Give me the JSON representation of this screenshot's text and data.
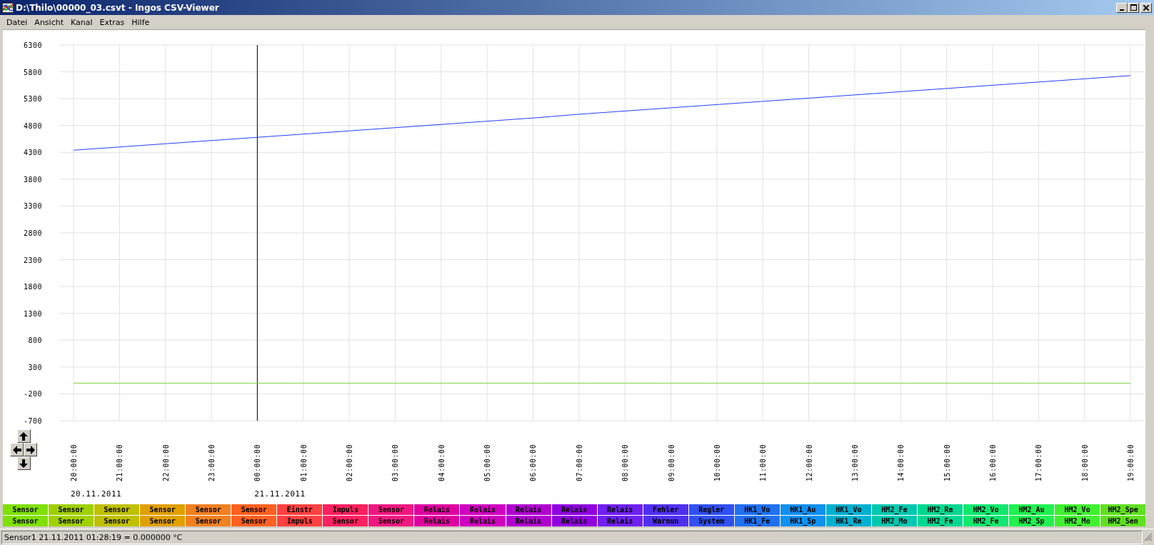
{
  "window": {
    "title": "D:\\Thilo\\00000_03.csvt - Ingos CSV-Viewer"
  },
  "menu": [
    {
      "label": "Datei"
    },
    {
      "label": "Ansicht"
    },
    {
      "label": "Kanal"
    },
    {
      "label": "Extras"
    },
    {
      "label": "Hilfe"
    }
  ],
  "chart": {
    "chart_data": {
      "type": "line",
      "categories": [
        "20:00:00",
        "21:00:00",
        "22:00:00",
        "23:00:00",
        "00:00:00",
        "01:00:00",
        "02:00:00",
        "03:00:00",
        "04:00:00",
        "05:00:00",
        "06:00:00",
        "07:00:00",
        "08:00:00",
        "09:00:00",
        "10:00:00",
        "11:00:00",
        "12:00:00",
        "13:00:00",
        "14:00:00",
        "15:00:00",
        "16:00:00",
        "17:00:00",
        "18:00:00",
        "19:00:00"
      ],
      "series": [
        {
          "color": "#2040ff",
          "values": [
            4340,
            4400,
            4460,
            4520,
            4580,
            4640,
            4700,
            4760,
            4820,
            4880,
            4940,
            5010,
            5070,
            5130,
            5190,
            5250,
            5310,
            5370,
            5430,
            5490,
            5550,
            5610,
            5670,
            5730
          ]
        },
        {
          "color": "#80d040",
          "values": [
            0,
            0,
            0,
            0,
            0,
            0,
            0,
            0,
            0,
            0,
            0,
            0,
            0,
            0,
            0,
            0,
            0,
            0,
            0,
            0,
            0,
            0,
            0,
            0
          ]
        }
      ],
      "ylim": [
        -700,
        6300
      ],
      "grid": true,
      "yticks": [
        6300,
        5800,
        5300,
        4800,
        4300,
        3800,
        3300,
        2800,
        2300,
        1800,
        1300,
        800,
        300,
        -200,
        -700
      ],
      "ref_lines": [
        {
          "axis": "x",
          "value": "00:00:00"
        }
      ]
    },
    "date_labels": [
      "20.11.2011",
      "21.11.2011"
    ]
  },
  "channel_rows": [
    [
      {
        "label": "Sensor",
        "color": "#80e000"
      },
      {
        "label": "Sensor",
        "color": "#a0d000"
      },
      {
        "label": "Sensor",
        "color": "#c0c000"
      },
      {
        "label": "Sensor",
        "color": "#e0a000"
      },
      {
        "label": "Sensor",
        "color": "#f08020"
      },
      {
        "label": "Sensor",
        "color": "#ff6020"
      },
      {
        "label": "Einstr",
        "color": "#ff4040"
      },
      {
        "label": "Impuls",
        "color": "#ff2060"
      },
      {
        "label": "Sensor",
        "color": "#f01880"
      },
      {
        "label": "Relais",
        "color": "#e000a0"
      },
      {
        "label": "Relais",
        "color": "#d000c0"
      },
      {
        "label": "Relais",
        "color": "#b000d0"
      },
      {
        "label": "Relais",
        "color": "#9000e0"
      },
      {
        "label": "Relais",
        "color": "#7020f0"
      },
      {
        "label": "Fehler",
        "color": "#5030f0"
      },
      {
        "label": "Regler",
        "color": "#3050f0"
      },
      {
        "label": "HK1_Vo",
        "color": "#2070f0"
      },
      {
        "label": "HK1_Au",
        "color": "#1090f0"
      },
      {
        "label": "HK1_Vo",
        "color": "#00b0d0"
      },
      {
        "label": "HM2_Fe",
        "color": "#00c8b0"
      },
      {
        "label": "HM2_Re",
        "color": "#00d890"
      },
      {
        "label": "HM2_Vo",
        "color": "#10e870"
      },
      {
        "label": "HM2_Au",
        "color": "#20f050"
      },
      {
        "label": "HM2_Vo",
        "color": "#40f030"
      },
      {
        "label": "HM2_Spe",
        "color": "#60e020"
      }
    ],
    [
      {
        "label": "Sensor",
        "color": "#80e000"
      },
      {
        "label": "Sensor",
        "color": "#a0d000"
      },
      {
        "label": "Sensor",
        "color": "#c0c000"
      },
      {
        "label": "Sensor",
        "color": "#e0a000"
      },
      {
        "label": "Sensor",
        "color": "#f08020"
      },
      {
        "label": "Sensor",
        "color": "#ff6020"
      },
      {
        "label": "Impuls",
        "color": "#ff4040"
      },
      {
        "label": "Sensor",
        "color": "#ff2060"
      },
      {
        "label": "Sensor",
        "color": "#f01880"
      },
      {
        "label": "Relais",
        "color": "#e000a0"
      },
      {
        "label": "Relais",
        "color": "#d000c0"
      },
      {
        "label": "Relais",
        "color": "#b000d0"
      },
      {
        "label": "Relais",
        "color": "#9000e0"
      },
      {
        "label": "Relais",
        "color": "#7020f0"
      },
      {
        "label": "Warnun",
        "color": "#5030f0"
      },
      {
        "label": "System",
        "color": "#3050f0"
      },
      {
        "label": "HK1_Fe",
        "color": "#2070f0"
      },
      {
        "label": "HK1_Sp",
        "color": "#1090f0"
      },
      {
        "label": "HK1_Re",
        "color": "#00b0d0"
      },
      {
        "label": "HM2_Mo",
        "color": "#00c8b0"
      },
      {
        "label": "HM2_Fe",
        "color": "#00d890"
      },
      {
        "label": "HM2_Fe",
        "color": "#10e870"
      },
      {
        "label": "HM2_Sp",
        "color": "#20f050"
      },
      {
        "label": "HM2_Mo",
        "color": "#40f030"
      },
      {
        "label": "HM2_Sen",
        "color": "#60e020"
      }
    ]
  ],
  "status_bar": {
    "text": "Sensor1 21.11.2011 01:28:19 = 0.000000 °C"
  }
}
